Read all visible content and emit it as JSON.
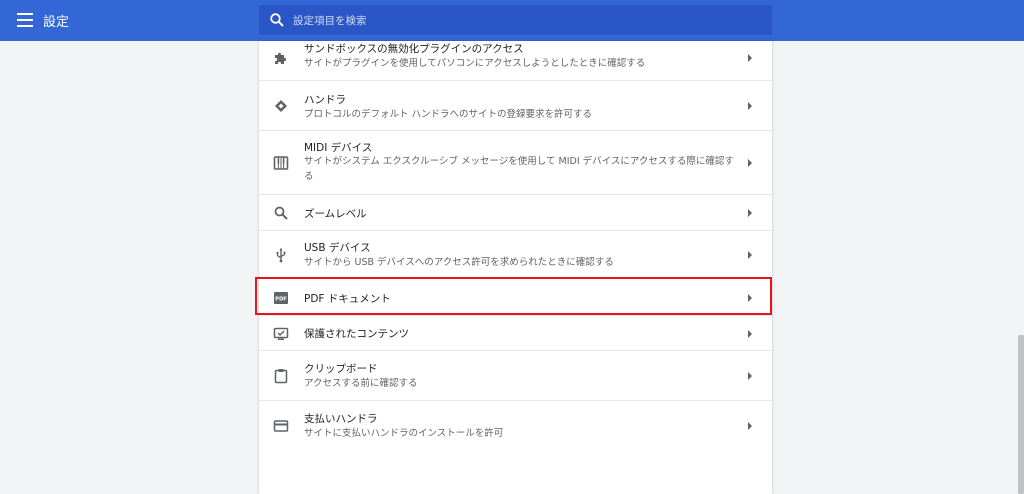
{
  "header": {
    "title": "設定",
    "search_placeholder": "設定項目を検索"
  },
  "rows": [
    {
      "title": "サンドボックスの無効化プラグインのアクセス",
      "desc": "サイトがプラグインを使用してパソコンにアクセスしようとしたときに確認する",
      "icon": "puzzle-icon"
    },
    {
      "title": "ハンドラ",
      "desc": "プロトコルのデフォルト ハンドラへのサイトの登録要求を許可する",
      "icon": "handler-diamond-icon"
    },
    {
      "title": "MIDI デバイス",
      "desc": "サイトがシステム エクスクルーシブ メッセージを使用して MIDI デバイスにアクセスする際に確認する",
      "icon": "piano-keys-icon"
    },
    {
      "title": "ズームレベル",
      "desc": "",
      "icon": "zoom-magnifier-icon"
    },
    {
      "title": "USB デバイス",
      "desc": "サイトから USB デバイスへのアクセス許可を求められたときに確認する",
      "icon": "usb-icon"
    },
    {
      "title": "PDF ドキュメント",
      "desc": "",
      "icon": "pdf-icon"
    },
    {
      "title": "保護されたコンテンツ",
      "desc": "",
      "icon": "protected-monitor-icon"
    },
    {
      "title": "クリップボード",
      "desc": "アクセスする前に確認する",
      "icon": "clipboard-icon"
    },
    {
      "title": "支払いハンドラ",
      "desc": "サイトに支払いハンドラのインストールを許可",
      "icon": "credit-card-icon"
    }
  ],
  "colors": {
    "header_bg": "#3367d6",
    "search_bg": "#2a56c6",
    "highlight": "#e8131b",
    "page_bg": "#f1f3f4"
  }
}
